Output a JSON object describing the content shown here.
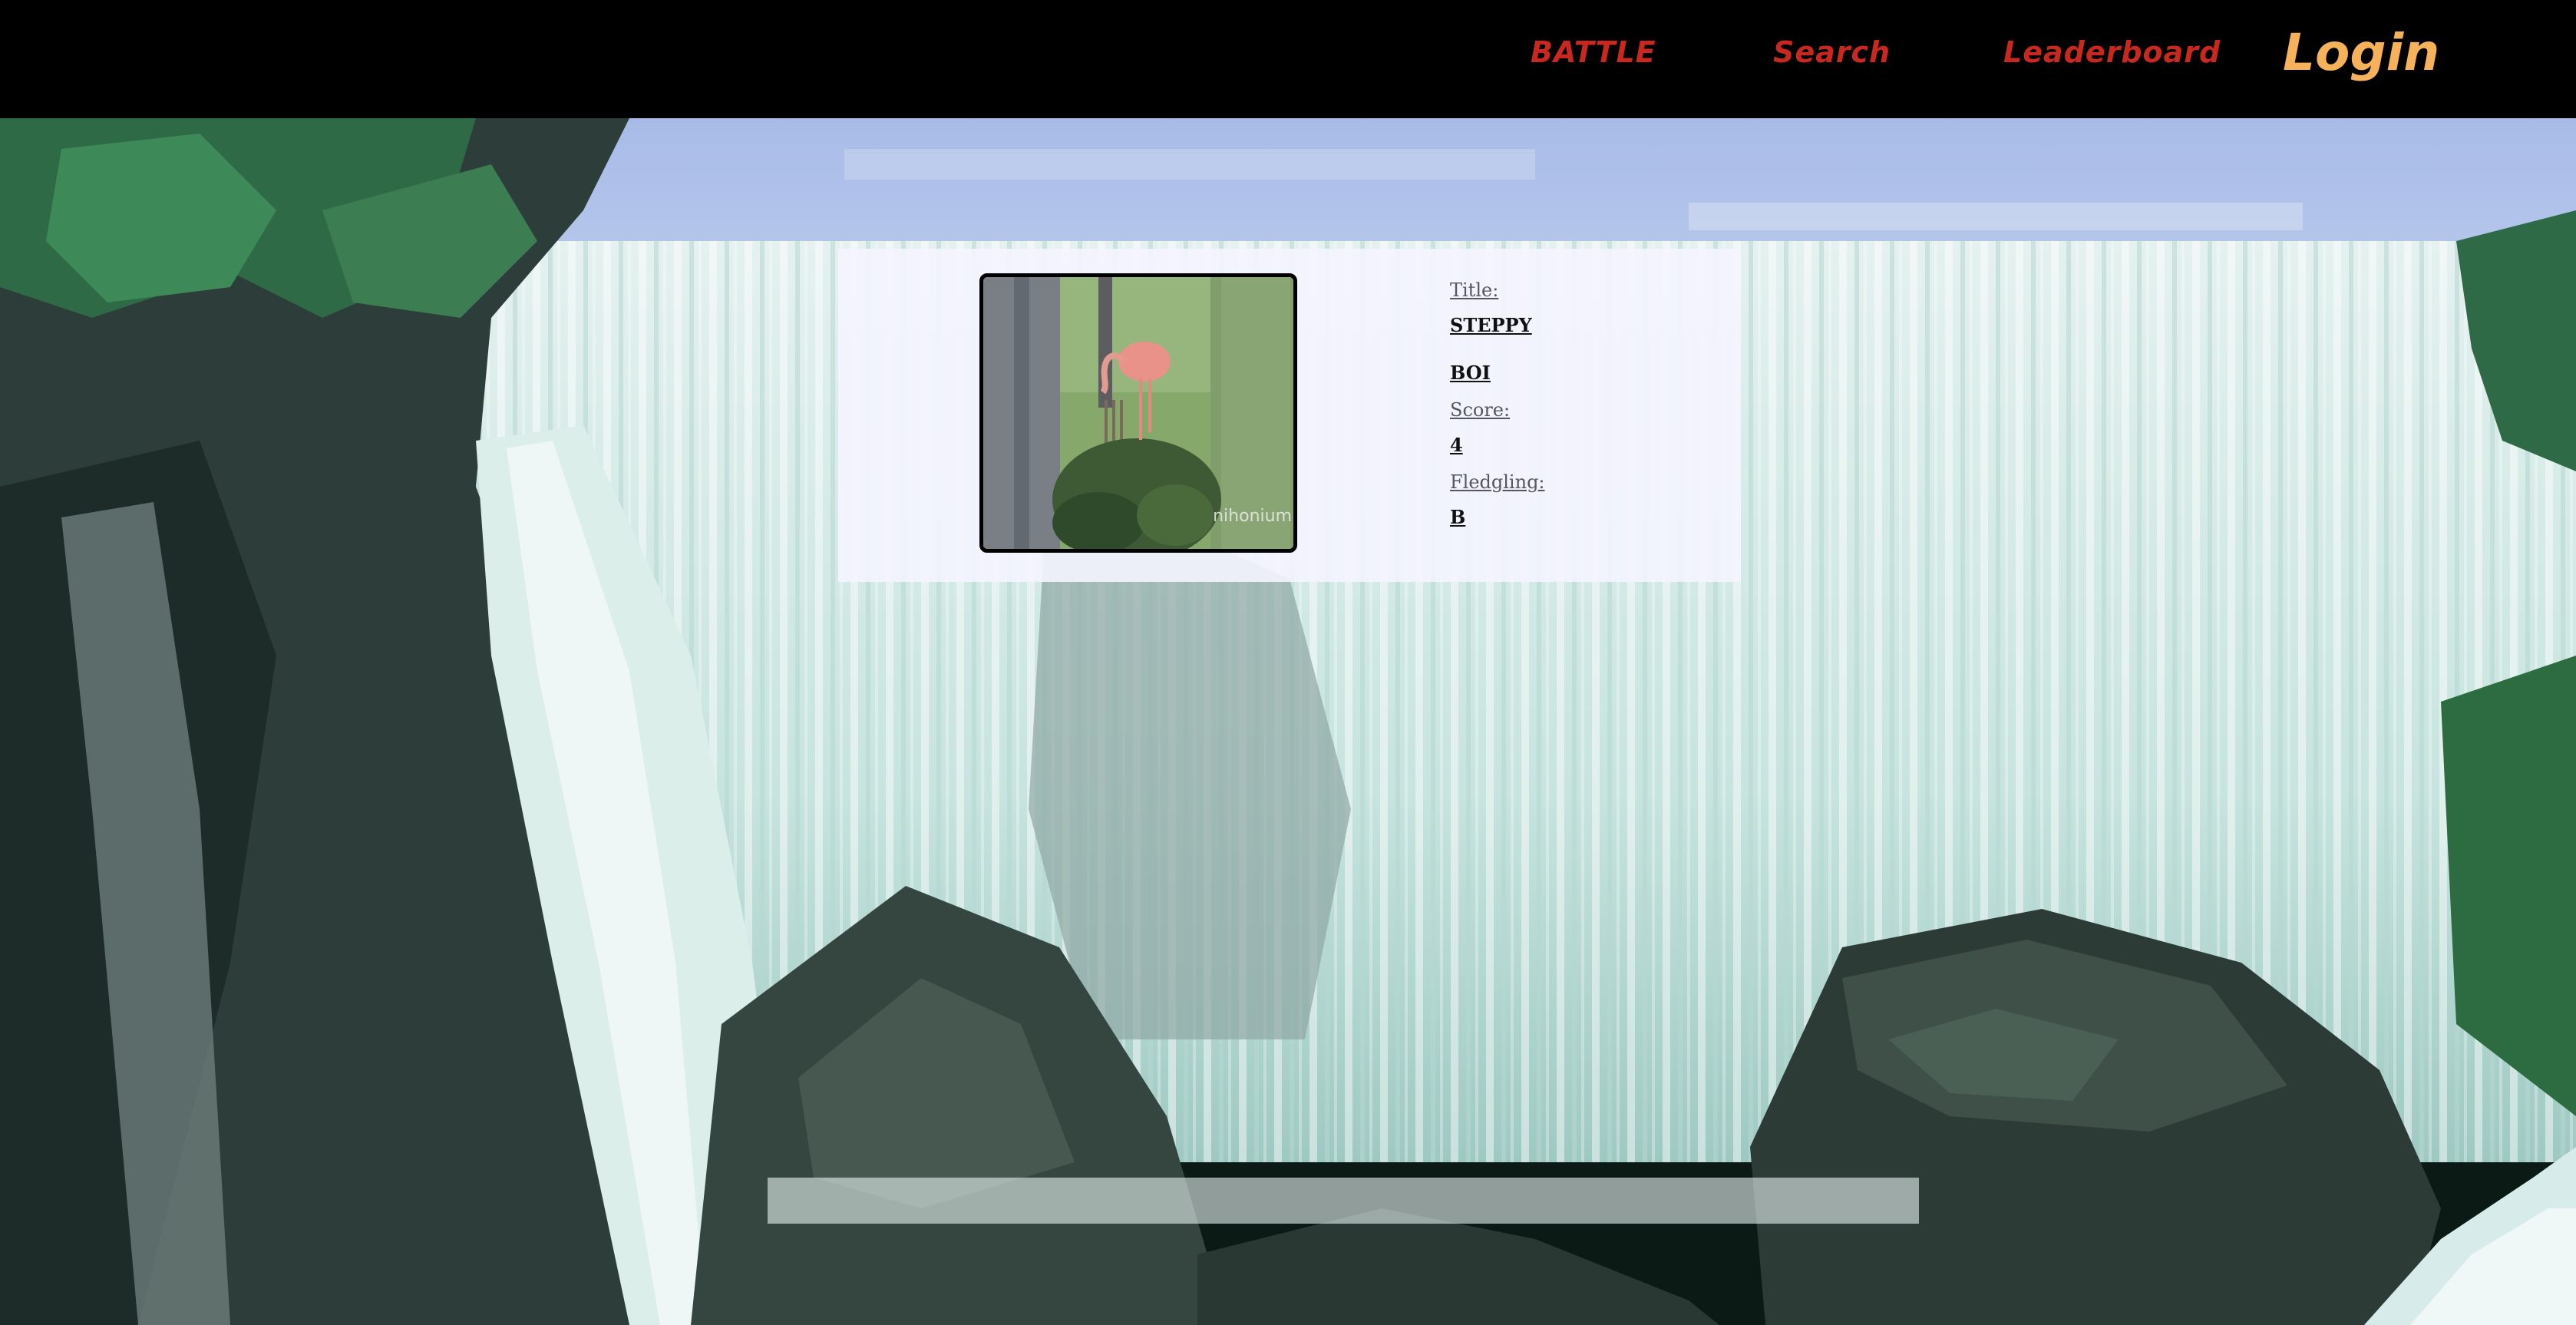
{
  "nav": {
    "battle": "BATTLE",
    "search": "Search",
    "leaderboard": "Leaderboard",
    "login": "Login"
  },
  "result_card": {
    "image_alt": "flamingo",
    "image_watermark": "nihonium",
    "title_label": "Title:",
    "title_line1": "STEPPY",
    "title_line2": "BOI",
    "score_label": "Score:",
    "score_value": "4",
    "fledgling_label": "Fledgling:",
    "fledgling_value": "B"
  },
  "colors": {
    "nav_background": "#000000",
    "nav_link": "#c8281e",
    "login": "#f6b25a",
    "card_background": "#f4f4ff"
  }
}
